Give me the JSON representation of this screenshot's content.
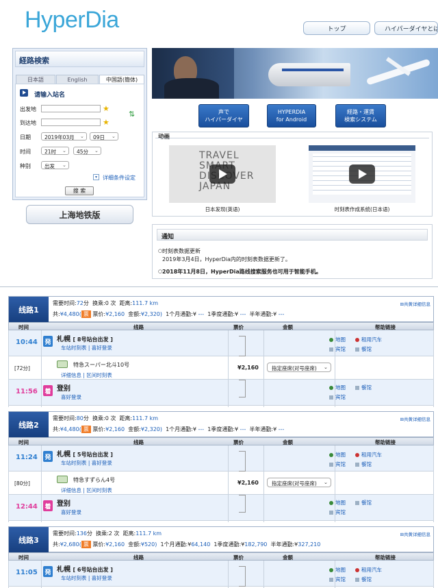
{
  "header": {
    "logo": "HyperDia",
    "nav": [
      "トップ",
      "ハイパーダイヤとは"
    ]
  },
  "search": {
    "title": "経路検索",
    "lang_tabs": [
      "日本語",
      "English",
      "中国語(簡体)"
    ],
    "prompt": "请输入站名",
    "from_label": "出发地",
    "to_label": "到达地",
    "date_label": "日期",
    "time_label": "时间",
    "type_label": "种别",
    "year_month": "2019年03月",
    "day": "09日",
    "hour": "21时",
    "minute": "45分",
    "type": "出发",
    "detail_link": "详细条件设定",
    "search_button": "搜 索"
  },
  "shanghai_button": "上海地铁版",
  "banner": {
    "buttons": [
      {
        "line1": "声で",
        "line2": "ハイパーダイヤ"
      },
      {
        "line1": "HYPERDIA",
        "line2": "for Android"
      },
      {
        "line1": "経路・運賃",
        "line2": "検索システム"
      }
    ]
  },
  "videos": {
    "title": "动画",
    "items": [
      {
        "caption": "日本发现(英语)",
        "thumb_text": [
          "TRAVEL",
          "SMART",
          "DISCOVER",
          "JAPAN"
        ]
      },
      {
        "caption": "时刻表作成系统(日本语)"
      }
    ]
  },
  "notice": {
    "title": "通知",
    "items": [
      {
        "title": "时刻表数据更新",
        "body": "2019年3月4日，HyperDia内的时刻表数据更新了。"
      },
      {
        "title": "2018年11月8日，HyperDia路线搜索服务也可用于智能手机。",
        "body": ""
      }
    ]
  },
  "table_headers": {
    "time": "时间",
    "route": "线路",
    "fare": "票价",
    "amount": "金额",
    "help": "帮助链接"
  },
  "labels": {
    "required_time": "需要时间:",
    "transfers": "换乘:",
    "distance": "距离:",
    "total": "共:",
    "ticket": "票",
    "fare": "票价:",
    "charge": "金额:",
    "m1": "1个月通勤:¥",
    "m3": "1季度通勤:¥",
    "m6": "半年通勤:¥",
    "detail": "共黄详细信息",
    "depart": "発",
    "arrive": "着",
    "timetable": "车站时刻表",
    "fav": "喜好登录",
    "train_info": "详细信息",
    "section_tt": "区间时刻表",
    "map": "地图",
    "rental": "租用汽车",
    "hotel": "宾馆",
    "meal": "餐馆"
  },
  "routes": [
    {
      "tag": "线路1",
      "time": "72",
      "time_unit": "分",
      "transfers": "0 次",
      "distance": "111.7 km",
      "total": "¥4,480(",
      "fare": "¥2,160",
      "charge": "¥2,320)",
      "m1": " ---",
      "m3": " ---",
      "m6": " ---",
      "dep_time": "10:44",
      "dep_station": "札幌",
      "dep_platform": "[ 8号站台出发 ]",
      "duration": "[72分]",
      "train": "特急スーパー北斗10号",
      "train_fare": "¥2,160",
      "seat": "指定座席(对号座席)",
      "arr_time": "11:56",
      "arr_station": "登别"
    },
    {
      "tag": "线路2",
      "time": "80",
      "time_unit": "分",
      "transfers": "0 次",
      "distance": "111.7 km",
      "total": "¥4,480(",
      "fare": "¥2,160",
      "charge": "¥2,320)",
      "m1": " ---",
      "m3": " ---",
      "m6": " ---",
      "dep_time": "11:24",
      "dep_station": "札幌",
      "dep_platform": "[ 5号站台出发 ]",
      "duration": "[80分]",
      "train": "特急すずらん4号",
      "train_fare": "¥2,160",
      "seat": "指定座席(对号座席)",
      "arr_time": "12:44",
      "arr_station": "登别"
    },
    {
      "tag": "线路3",
      "time": "136",
      "time_unit": "分",
      "transfers": "2 次",
      "distance": "111.7 km",
      "total": "¥2,680(",
      "fare": "¥2,160",
      "charge": "¥520)",
      "m1": "64,140",
      "m3": "182,790",
      "m6": "327,210",
      "dep_time": "11:05",
      "dep_station": "札幌",
      "dep_platform": "[ 6号站台出发 ]"
    }
  ],
  "colors": {
    "accent": "#1b5eb8",
    "route_tag": "#1f4b91",
    "depart": "#2f7fd0",
    "arrive": "#e03c9c",
    "pay": "#f07c27"
  }
}
